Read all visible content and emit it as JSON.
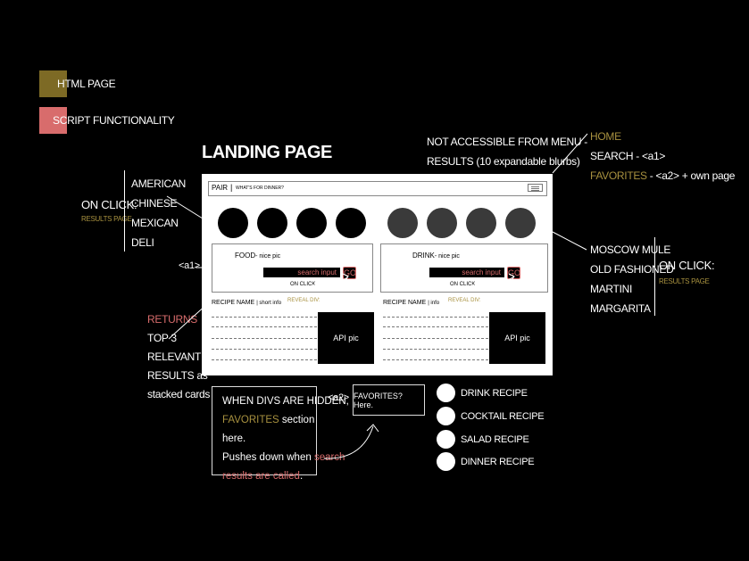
{
  "legend": {
    "items": [
      {
        "label": "HTML PAGE",
        "color": "#7d6a25"
      },
      {
        "label": "SCRIPT FUNCTIONALITY",
        "color": "#d86c6c"
      }
    ]
  },
  "landing": {
    "title": "LANDING PAGE",
    "header_logo": "PAIR",
    "header_tagline": "WHAT'S FOR DINNER?",
    "food_label": "FOOD",
    "food_note": "- nice pic",
    "drink_label": "DRINK",
    "drink_note": "- nice pic",
    "search_placeholder": "search input",
    "go_label": "GO",
    "on_click": "ON CLICK",
    "recipe_name_left": "RECIPE NAME",
    "recipe_info_left": "| short info",
    "recipe_name_right": "RECIPE NAME",
    "recipe_info_right": "| info",
    "reveal_div": "REVEAL DIV:",
    "api_pic": "API pic"
  },
  "left_annot": {
    "on_click": "ON CLICK:",
    "results_page": "RESULTS PAGE",
    "cuisines": [
      "AMERICAN",
      "CHINESE",
      "MEXICAN",
      "DELI"
    ],
    "a1": "<a1>"
  },
  "returns": {
    "returns": "RETURNS",
    "lines": [
      "TOP 3",
      "RELEVANT",
      "RESULTS as",
      "stacked cards"
    ]
  },
  "top_note": {
    "line1": "NOT ACCESSIBLE FROM MENU -",
    "line2": "RESULTS (10 expandable blurbs)"
  },
  "menu_note": {
    "home": "HOME",
    "search": "SEARCH - <a1>",
    "favorites": "FAVORITES",
    "favorites_rest": " - <a2> + own page"
  },
  "right_annot": {
    "drinks": [
      "MOSCOW MULE",
      "OLD FASHIONED",
      "MARTINI",
      "MARGARITA"
    ],
    "on_click": "ON CLICK:",
    "results_page": "RESULTS PAGE"
  },
  "hidden_note": {
    "l1": "WHEN DIVS ARE HIDDEN,",
    "fav": "FAVORITES",
    "l2rest": " section here.",
    "l3a": "Pushes down when ",
    "l3b": "search",
    "l4a": "results are called",
    "l4b": "."
  },
  "favorites_box": {
    "a2": "<a2>",
    "label": "FAVORITES? Here."
  },
  "recipe_types": [
    "DRINK RECIPE",
    "COCKTAIL RECIPE",
    "SALAD RECIPE",
    "DINNER RECIPE"
  ]
}
